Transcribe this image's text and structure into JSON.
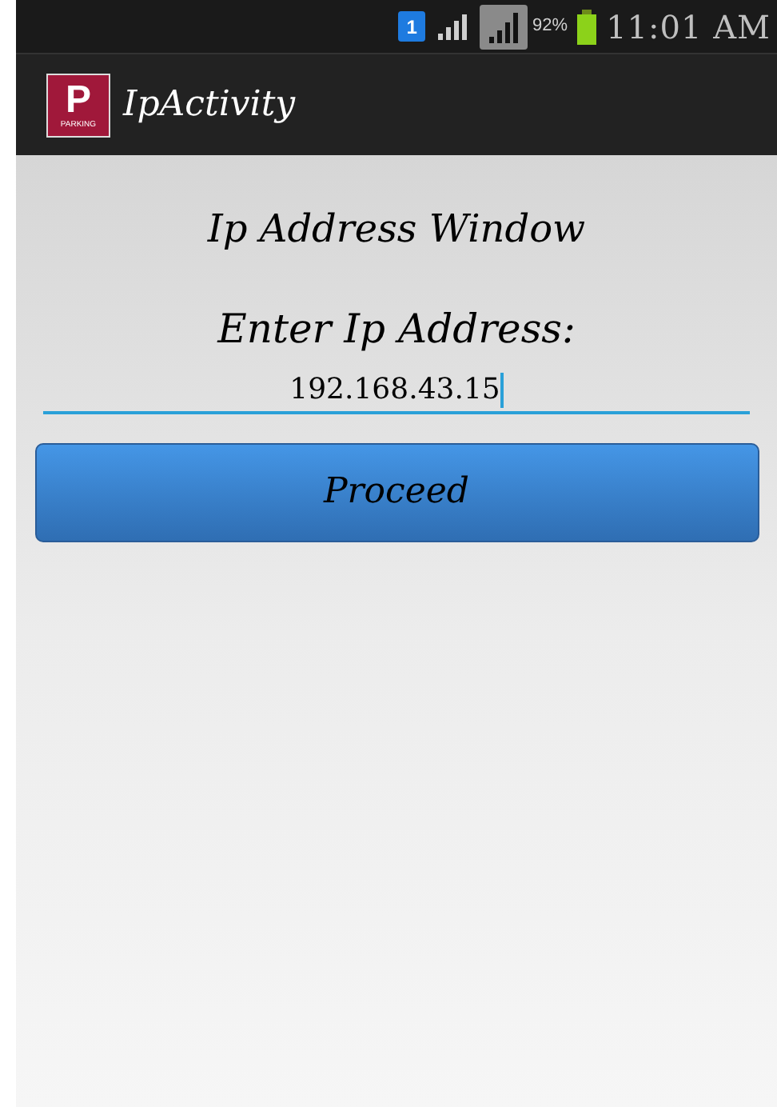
{
  "status_bar": {
    "sim_badge": "1",
    "battery_percent": "92%",
    "time": "11:01 AM"
  },
  "app_bar": {
    "logo": {
      "letter": "P",
      "caption": "PARKING"
    },
    "title": "IpActivity"
  },
  "heading": "Ip Address Window",
  "ip_field": {
    "label": "Enter Ip Address:",
    "value": "192.168.43.15",
    "focused": true
  },
  "buttons": [
    "Proceed"
  ]
}
